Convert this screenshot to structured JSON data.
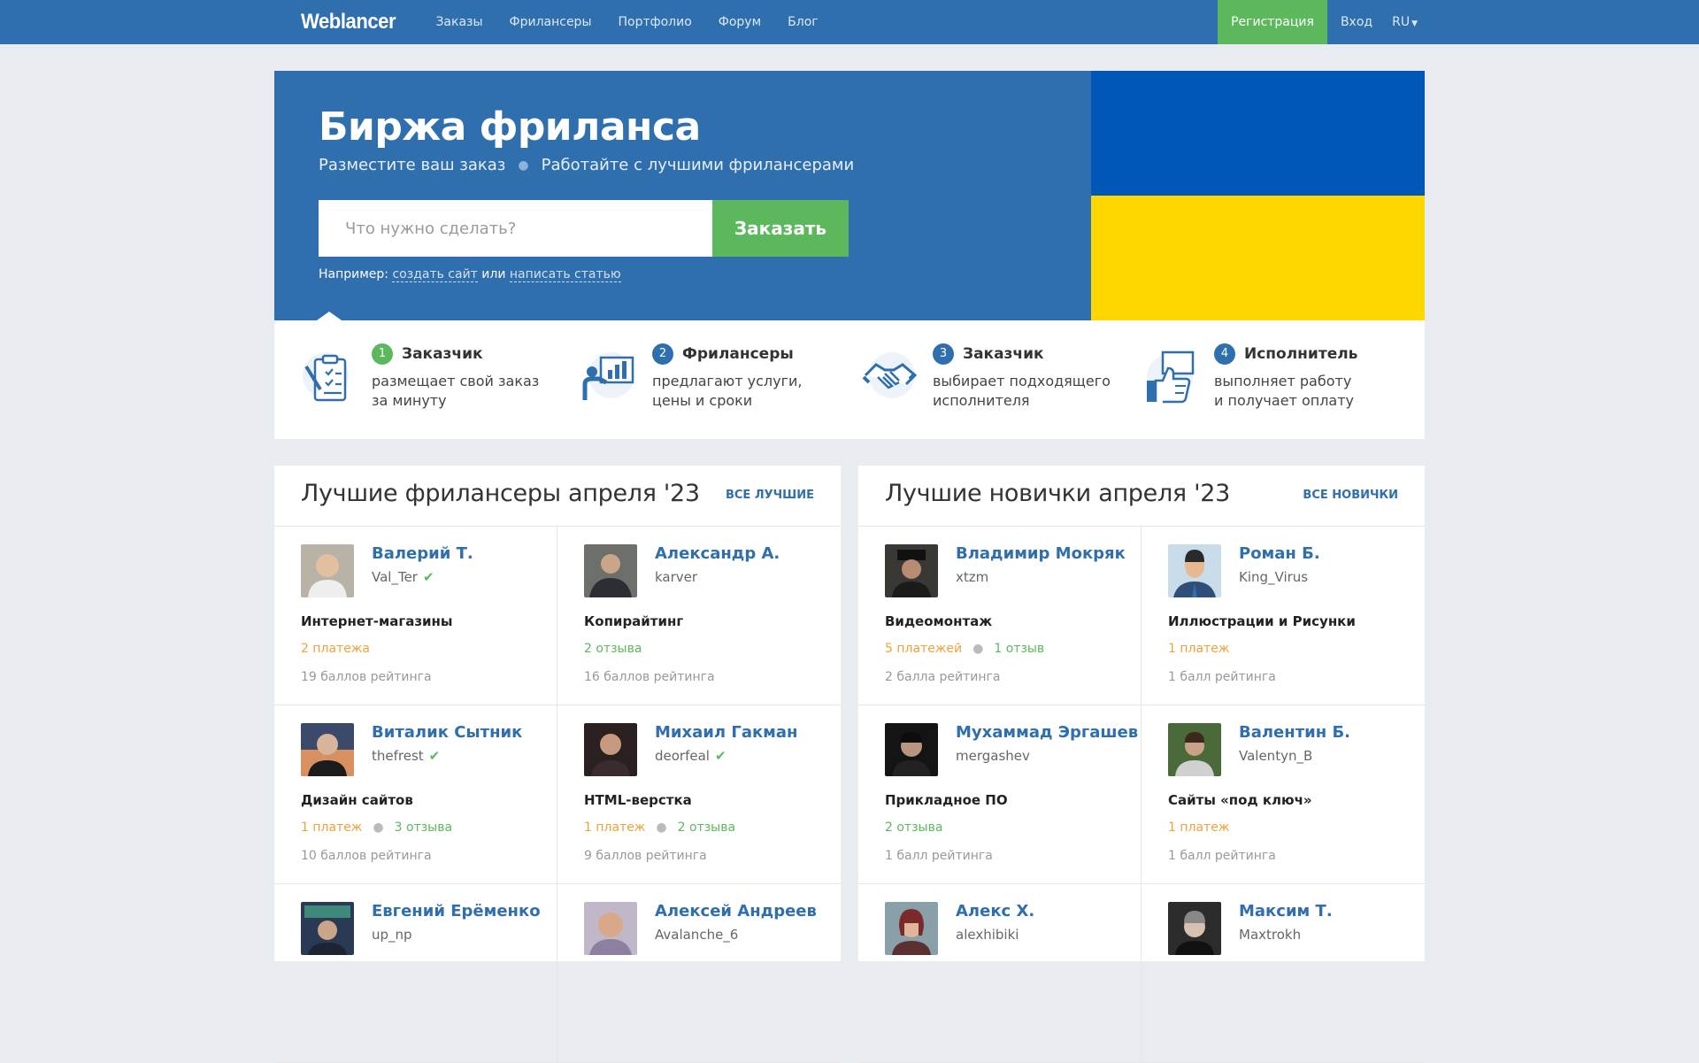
{
  "nav": {
    "logo": "Weblancer",
    "links": [
      "Заказы",
      "Фрилансеры",
      "Портфолио",
      "Форум",
      "Блог"
    ],
    "register": "Регистрация",
    "login": "Вход",
    "lang": "RU"
  },
  "hero": {
    "title": "Биржа фриланса",
    "sub1": "Разместите ваш заказ",
    "sub2": "Работайте с лучшими фрилансерами",
    "search_placeholder": "Что нужно сделать?",
    "order_button": "Заказать",
    "example_prefix": "Например:",
    "example_link1": "создать сайт",
    "example_or": "или",
    "example_link2": "написать статью",
    "flag_colors": [
      "#0057b8",
      "#ffd700"
    ]
  },
  "steps": [
    {
      "num": "1",
      "title": "Заказчик",
      "line1": "размещает свой заказ",
      "line2": "за минуту"
    },
    {
      "num": "2",
      "title": "Фрилансеры",
      "line1": "предлагают услуги,",
      "line2": "цены и сроки"
    },
    {
      "num": "3",
      "title": "Заказчик",
      "line1": "выбирает подходящего",
      "line2": "исполнителя"
    },
    {
      "num": "4",
      "title": "Исполнитель",
      "line1": "выполняет работу",
      "line2": "и получает оплату"
    }
  ],
  "best": {
    "title": "Лучшие фрилансеры апреля '23",
    "link": "ВСЕ ЛУЧШИЕ",
    "people": [
      {
        "name": "Валерий Т.",
        "login": "Val_Ter",
        "verified": "✔",
        "category": "Интернет-магазины",
        "payments": "2 платежа",
        "reviews": "",
        "rating": "19 баллов рейтинга"
      },
      {
        "name": "Александр А.",
        "login": "karver",
        "verified": "",
        "category": "Копирайтинг",
        "payments": "",
        "reviews": "2 отзыва",
        "rating": "16 баллов рейтинга"
      },
      {
        "name": "Виталик Сытник",
        "login": "thefrest",
        "verified": "✔",
        "category": "Дизайн сайтов",
        "payments": "1 платеж",
        "reviews": "3 отзыва",
        "rating": "10 баллов рейтинга"
      },
      {
        "name": "Михаил Гакман",
        "login": "deorfeal",
        "verified": "✔",
        "category": "HTML-верстка",
        "payments": "1 платеж",
        "reviews": "2 отзыва",
        "rating": "9 баллов рейтинга"
      },
      {
        "name": "Евгений Ерёменко",
        "login": "up_np",
        "verified": "",
        "category": "",
        "payments": "",
        "reviews": "",
        "rating": ""
      },
      {
        "name": "Алексей Андреев",
        "login": "Avalanche_6",
        "verified": "",
        "category": "",
        "payments": "",
        "reviews": "",
        "rating": ""
      }
    ]
  },
  "newbies": {
    "title": "Лучшие новички апреля '23",
    "link": "ВСЕ НОВИЧКИ",
    "people": [
      {
        "name": "Владимир Мокряк",
        "login": "xtzm",
        "verified": "",
        "category": "Видеомонтаж",
        "payments": "5 платежей",
        "reviews": "1 отзыв",
        "rating": "2 балла рейтинга"
      },
      {
        "name": "Роман Б.",
        "login": "King_Virus",
        "verified": "",
        "category": "Иллюстрации и Рисунки",
        "payments": "1 платеж",
        "reviews": "",
        "rating": "1 балл рейтинга"
      },
      {
        "name": "Мухаммад Эргашев",
        "login": "mergashev",
        "verified": "",
        "category": "Прикладное ПО",
        "payments": "",
        "reviews": "2 отзыва",
        "rating": "1 балл рейтинга"
      },
      {
        "name": "Валентин Б.",
        "login": "Valentyn_B",
        "verified": "",
        "category": "Сайты «под ключ»",
        "payments": "1 платеж",
        "reviews": "",
        "rating": "1 балл рейтинга"
      },
      {
        "name": "Алекс Х.",
        "login": "alexhibiki",
        "verified": "",
        "category": "",
        "payments": "",
        "reviews": "",
        "rating": ""
      },
      {
        "name": "Максим Т.",
        "login": "Maxtrokh",
        "verified": "",
        "category": "",
        "payments": "",
        "reviews": "",
        "rating": ""
      }
    ]
  },
  "icons": [
    "clipboard-pen-icon",
    "presentation-chart-icon",
    "handshake-icon",
    "thumbs-up-icon"
  ],
  "colors": {
    "brand_blue": "#2f6fad",
    "green": "#5cb85c",
    "orange": "#f0a23a"
  }
}
